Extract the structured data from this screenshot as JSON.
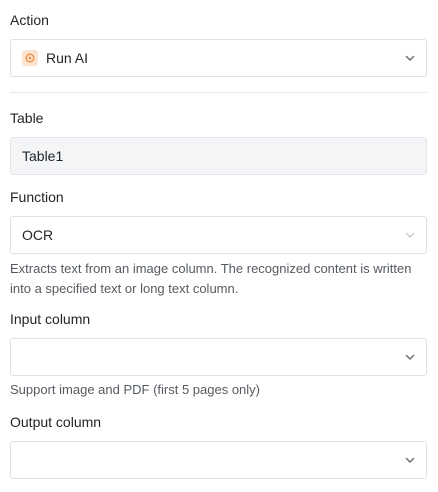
{
  "action": {
    "label": "Action",
    "value": "Run AI",
    "icon": "ai-sparkle-icon",
    "icon_color": "#f08a3e"
  },
  "table": {
    "label": "Table",
    "value": "Table1"
  },
  "function": {
    "label": "Function",
    "value": "OCR",
    "description": "Extracts text from an image column. The recognized content is written into a specified text or long text column."
  },
  "input_column": {
    "label": "Input column",
    "value": "",
    "hint": "Support image and PDF (first 5 pages only)"
  },
  "output_column": {
    "label": "Output column",
    "value": ""
  }
}
